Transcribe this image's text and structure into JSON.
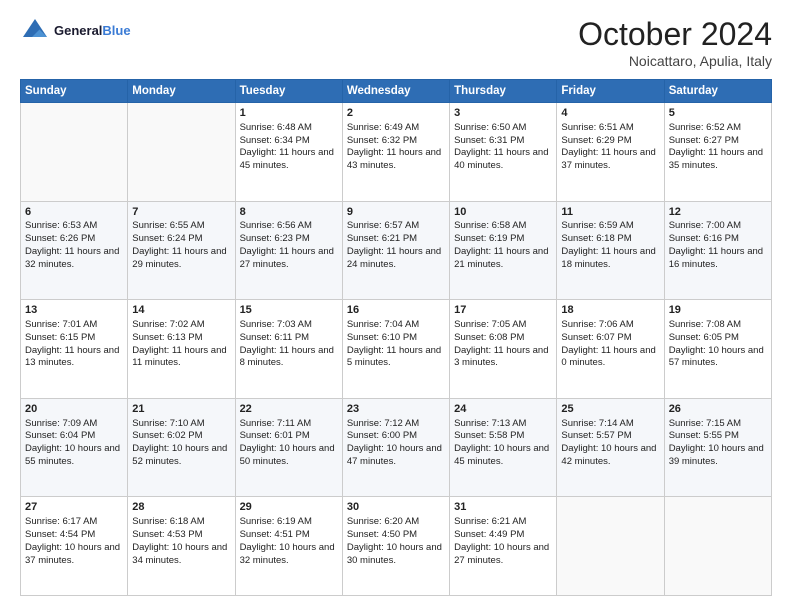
{
  "header": {
    "logo_line1": "General",
    "logo_line2": "Blue",
    "month": "October 2024",
    "location": "Noicattaro, Apulia, Italy"
  },
  "days_of_week": [
    "Sunday",
    "Monday",
    "Tuesday",
    "Wednesday",
    "Thursday",
    "Friday",
    "Saturday"
  ],
  "weeks": [
    [
      {
        "day": "",
        "sunrise": "",
        "sunset": "",
        "daylight": ""
      },
      {
        "day": "",
        "sunrise": "",
        "sunset": "",
        "daylight": ""
      },
      {
        "day": "1",
        "sunrise": "Sunrise: 6:48 AM",
        "sunset": "Sunset: 6:34 PM",
        "daylight": "Daylight: 11 hours and 45 minutes."
      },
      {
        "day": "2",
        "sunrise": "Sunrise: 6:49 AM",
        "sunset": "Sunset: 6:32 PM",
        "daylight": "Daylight: 11 hours and 43 minutes."
      },
      {
        "day": "3",
        "sunrise": "Sunrise: 6:50 AM",
        "sunset": "Sunset: 6:31 PM",
        "daylight": "Daylight: 11 hours and 40 minutes."
      },
      {
        "day": "4",
        "sunrise": "Sunrise: 6:51 AM",
        "sunset": "Sunset: 6:29 PM",
        "daylight": "Daylight: 11 hours and 37 minutes."
      },
      {
        "day": "5",
        "sunrise": "Sunrise: 6:52 AM",
        "sunset": "Sunset: 6:27 PM",
        "daylight": "Daylight: 11 hours and 35 minutes."
      }
    ],
    [
      {
        "day": "6",
        "sunrise": "Sunrise: 6:53 AM",
        "sunset": "Sunset: 6:26 PM",
        "daylight": "Daylight: 11 hours and 32 minutes."
      },
      {
        "day": "7",
        "sunrise": "Sunrise: 6:55 AM",
        "sunset": "Sunset: 6:24 PM",
        "daylight": "Daylight: 11 hours and 29 minutes."
      },
      {
        "day": "8",
        "sunrise": "Sunrise: 6:56 AM",
        "sunset": "Sunset: 6:23 PM",
        "daylight": "Daylight: 11 hours and 27 minutes."
      },
      {
        "day": "9",
        "sunrise": "Sunrise: 6:57 AM",
        "sunset": "Sunset: 6:21 PM",
        "daylight": "Daylight: 11 hours and 24 minutes."
      },
      {
        "day": "10",
        "sunrise": "Sunrise: 6:58 AM",
        "sunset": "Sunset: 6:19 PM",
        "daylight": "Daylight: 11 hours and 21 minutes."
      },
      {
        "day": "11",
        "sunrise": "Sunrise: 6:59 AM",
        "sunset": "Sunset: 6:18 PM",
        "daylight": "Daylight: 11 hours and 18 minutes."
      },
      {
        "day": "12",
        "sunrise": "Sunrise: 7:00 AM",
        "sunset": "Sunset: 6:16 PM",
        "daylight": "Daylight: 11 hours and 16 minutes."
      }
    ],
    [
      {
        "day": "13",
        "sunrise": "Sunrise: 7:01 AM",
        "sunset": "Sunset: 6:15 PM",
        "daylight": "Daylight: 11 hours and 13 minutes."
      },
      {
        "day": "14",
        "sunrise": "Sunrise: 7:02 AM",
        "sunset": "Sunset: 6:13 PM",
        "daylight": "Daylight: 11 hours and 11 minutes."
      },
      {
        "day": "15",
        "sunrise": "Sunrise: 7:03 AM",
        "sunset": "Sunset: 6:11 PM",
        "daylight": "Daylight: 11 hours and 8 minutes."
      },
      {
        "day": "16",
        "sunrise": "Sunrise: 7:04 AM",
        "sunset": "Sunset: 6:10 PM",
        "daylight": "Daylight: 11 hours and 5 minutes."
      },
      {
        "day": "17",
        "sunrise": "Sunrise: 7:05 AM",
        "sunset": "Sunset: 6:08 PM",
        "daylight": "Daylight: 11 hours and 3 minutes."
      },
      {
        "day": "18",
        "sunrise": "Sunrise: 7:06 AM",
        "sunset": "Sunset: 6:07 PM",
        "daylight": "Daylight: 11 hours and 0 minutes."
      },
      {
        "day": "19",
        "sunrise": "Sunrise: 7:08 AM",
        "sunset": "Sunset: 6:05 PM",
        "daylight": "Daylight: 10 hours and 57 minutes."
      }
    ],
    [
      {
        "day": "20",
        "sunrise": "Sunrise: 7:09 AM",
        "sunset": "Sunset: 6:04 PM",
        "daylight": "Daylight: 10 hours and 55 minutes."
      },
      {
        "day": "21",
        "sunrise": "Sunrise: 7:10 AM",
        "sunset": "Sunset: 6:02 PM",
        "daylight": "Daylight: 10 hours and 52 minutes."
      },
      {
        "day": "22",
        "sunrise": "Sunrise: 7:11 AM",
        "sunset": "Sunset: 6:01 PM",
        "daylight": "Daylight: 10 hours and 50 minutes."
      },
      {
        "day": "23",
        "sunrise": "Sunrise: 7:12 AM",
        "sunset": "Sunset: 6:00 PM",
        "daylight": "Daylight: 10 hours and 47 minutes."
      },
      {
        "day": "24",
        "sunrise": "Sunrise: 7:13 AM",
        "sunset": "Sunset: 5:58 PM",
        "daylight": "Daylight: 10 hours and 45 minutes."
      },
      {
        "day": "25",
        "sunrise": "Sunrise: 7:14 AM",
        "sunset": "Sunset: 5:57 PM",
        "daylight": "Daylight: 10 hours and 42 minutes."
      },
      {
        "day": "26",
        "sunrise": "Sunrise: 7:15 AM",
        "sunset": "Sunset: 5:55 PM",
        "daylight": "Daylight: 10 hours and 39 minutes."
      }
    ],
    [
      {
        "day": "27",
        "sunrise": "Sunrise: 6:17 AM",
        "sunset": "Sunset: 4:54 PM",
        "daylight": "Daylight: 10 hours and 37 minutes."
      },
      {
        "day": "28",
        "sunrise": "Sunrise: 6:18 AM",
        "sunset": "Sunset: 4:53 PM",
        "daylight": "Daylight: 10 hours and 34 minutes."
      },
      {
        "day": "29",
        "sunrise": "Sunrise: 6:19 AM",
        "sunset": "Sunset: 4:51 PM",
        "daylight": "Daylight: 10 hours and 32 minutes."
      },
      {
        "day": "30",
        "sunrise": "Sunrise: 6:20 AM",
        "sunset": "Sunset: 4:50 PM",
        "daylight": "Daylight: 10 hours and 30 minutes."
      },
      {
        "day": "31",
        "sunrise": "Sunrise: 6:21 AM",
        "sunset": "Sunset: 4:49 PM",
        "daylight": "Daylight: 10 hours and 27 minutes."
      },
      {
        "day": "",
        "sunrise": "",
        "sunset": "",
        "daylight": ""
      },
      {
        "day": "",
        "sunrise": "",
        "sunset": "",
        "daylight": ""
      }
    ]
  ]
}
